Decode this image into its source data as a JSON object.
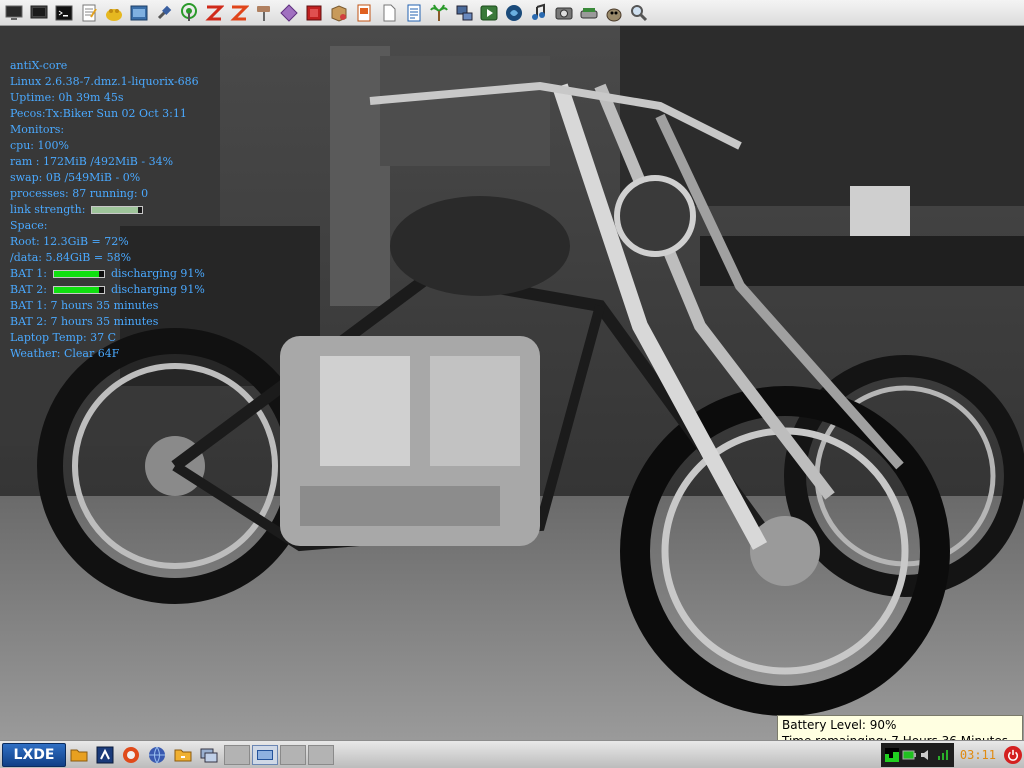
{
  "top_bar": {
    "launchers": [
      {
        "icon": "monitor-icon"
      },
      {
        "icon": "display-icon"
      },
      {
        "icon": "terminal-icon"
      },
      {
        "icon": "text-editor-icon"
      },
      {
        "icon": "file-cabinet-icon"
      },
      {
        "icon": "screenshot-icon"
      },
      {
        "icon": "network-plug-icon"
      },
      {
        "icon": "wifi-antenna-icon"
      },
      {
        "icon": "zip-tool-icon"
      },
      {
        "icon": "zip-archive-icon"
      },
      {
        "icon": "paint-roller-icon"
      },
      {
        "icon": "diamond-app-icon"
      },
      {
        "icon": "red-square-icon"
      },
      {
        "icon": "package-box-icon"
      },
      {
        "icon": "office-presentation-icon"
      },
      {
        "icon": "blank-document-icon"
      },
      {
        "icon": "writer-document-icon"
      },
      {
        "icon": "palm-tree-icon"
      },
      {
        "icon": "network-computer-icon"
      },
      {
        "icon": "media-player-icon"
      },
      {
        "icon": "swirl-app-icon"
      },
      {
        "icon": "music-note-icon"
      },
      {
        "icon": "camera-icon"
      },
      {
        "icon": "scanner-icon"
      },
      {
        "icon": "gimp-icon"
      },
      {
        "icon": "magnifier-icon"
      }
    ]
  },
  "conky": {
    "os": "antiX-core",
    "kernel": "Linux 2.6.38-7.dmz.1-liquorix-686",
    "uptime": "Uptime: 0h 39m 45s",
    "host_date": "Pecos:Tx:Biker  Sun 02 Oct  3:11",
    "monitors": "Monitors:",
    "cpu": "cpu: 100%",
    "ram": "ram : 172MiB /492MiB  - 34%",
    "swap": "swap: 0B   /549MiB  - 0%",
    "processes": "processes: 87    running: 0",
    "link_label": "link strength:",
    "link_level": 0.92,
    "space": "Space:",
    "root": "Root: 12.3GiB = 72%",
    "data_disk": "/data: 5.84GiB = 58%",
    "bat1_label": "BAT 1:",
    "bat1_level": 0.91,
    "bat1_status": "discharging 91%",
    "bat2_label": "BAT 2:",
    "bat2_level": 0.91,
    "bat2_status": "discharging 91%",
    "bat1_time": "BAT 1: 7 hours 35 minutes",
    "bat2_time": "BAT 2: 7 hours 35 minutes",
    "laptop_temp": "Laptop Temp:  37 C",
    "weather": "Weather: Clear  64F"
  },
  "tooltip": {
    "line1": "Battery Level: 90%",
    "line2": "Time remainging: 7 Hours 36 Minutes"
  },
  "taskbar": {
    "start_label": "LXDE",
    "launchers": [
      {
        "icon": "file-manager-icon"
      },
      {
        "icon": "run-app-icon"
      },
      {
        "icon": "browser-icon"
      },
      {
        "icon": "network-globe-icon"
      },
      {
        "icon": "home-folder-icon"
      },
      {
        "icon": "show-desktop-icon"
      }
    ],
    "desktops": [
      {
        "active": false
      },
      {
        "active": true
      },
      {
        "active": false
      },
      {
        "active": false
      }
    ],
    "clock": "03:11"
  },
  "colors": {
    "conky_text": "#4aa9ff",
    "battery_fill": "#10e010",
    "clock": "#e08a10",
    "tooltip_bg": "#ffffe1"
  }
}
